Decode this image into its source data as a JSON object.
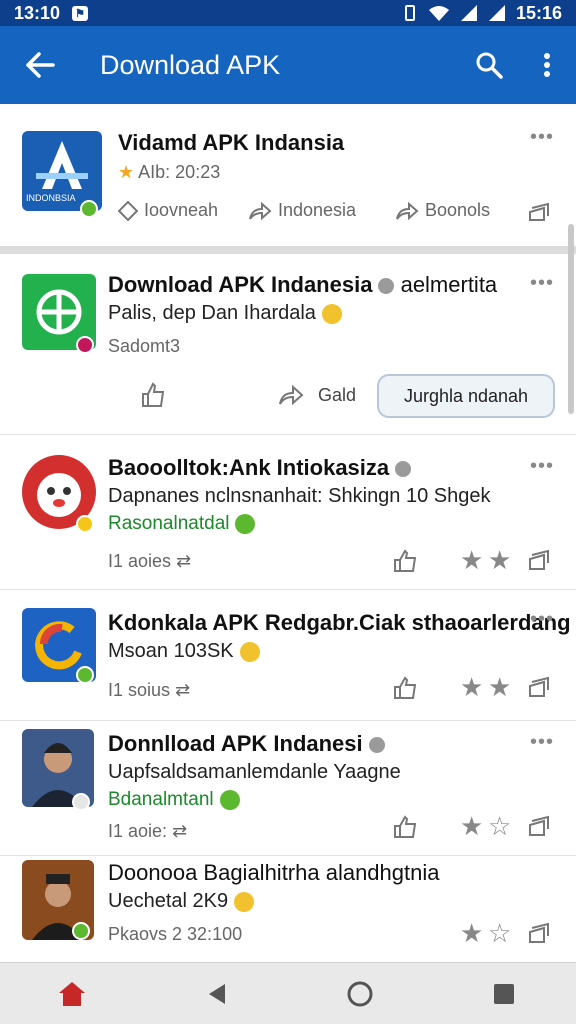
{
  "status": {
    "time": "13:10",
    "right_time": "15:16"
  },
  "appbar": {
    "title": "Download APK"
  },
  "featured": {
    "title": "Vidamd APK Indansia",
    "meta": "AIb: 20:23",
    "actions": [
      "Ioovneah",
      "Indonesia",
      "Boonols"
    ],
    "icon_text": "INDONBSIA"
  },
  "app2": {
    "title": "Download APK Indanesia",
    "title_suffix": "aelmertita",
    "line2": "Palis, dep Dan Ihardala",
    "line3": "Sadomt3",
    "action_label": "Gald",
    "pill": "Jurghla ndanah"
  },
  "items": [
    {
      "title": "Baooolltok:Ank Intiokasiza",
      "line2": "Dapnanes nclnsnanhait: Shkingn 10 Shgek",
      "line3": "Rasonalnatdal",
      "meta": "I1 aoies"
    },
    {
      "title": "Kdonkala APK Redgabr.Ciak sthaoarlerdang",
      "line2": "Msoan 103SK",
      "line3": "",
      "meta": "I1 soius"
    },
    {
      "title": "Donnlload APK Indanesi",
      "line2": "Uapfsaldsamanlemdanle Yaagne",
      "line3": "Bdanalmtanl",
      "meta": "I1 aoie:"
    },
    {
      "title": "Doonooa Bagialhitrha alandhgtnia",
      "line2": "Uechetal 2K9",
      "line3": "",
      "meta": "Pkaovs 2 32:100"
    }
  ],
  "colors": {
    "appbar": "#1565c0",
    "statusbar": "#0d3f8c",
    "accent_green": "#1a8a2a"
  }
}
